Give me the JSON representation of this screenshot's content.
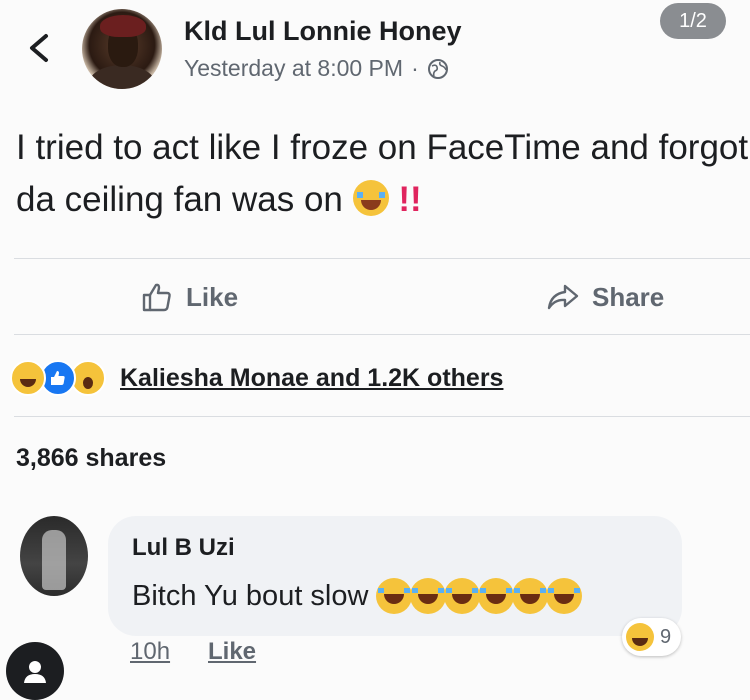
{
  "header": {
    "author": "Kld Lul Lonnie Honey",
    "timestamp": "Yesterday at 8:00 PM",
    "separator": "·",
    "privacy_icon": "globe-icon",
    "pager": "1/2"
  },
  "post": {
    "text": "I tried to act like I froze on FaceTime and forgot da ceiling fan was on",
    "trailing_emoji": "crying-face-icon",
    "trailing_marks": "!!"
  },
  "actions": {
    "like_label": "Like",
    "share_label": "Share"
  },
  "reactions": {
    "icons": [
      "haha-reaction-icon",
      "like-reaction-icon",
      "wow-reaction-icon"
    ],
    "summary": "Kaliesha Monae and 1.2K others"
  },
  "shares": "3,866 shares",
  "comment": {
    "author": "Lul B Uzi",
    "text": "Bitch Yu bout slow",
    "emoji_count": 6,
    "time": "10h",
    "like_label": "Like",
    "reaction_count": "9"
  },
  "colors": {
    "accent_blue": "#1877f2",
    "secondary_text": "#606770",
    "bubble": "#f0f2f5",
    "emphasis_red": "#e0245e"
  }
}
